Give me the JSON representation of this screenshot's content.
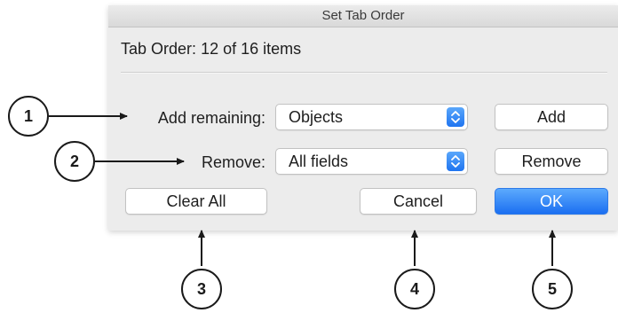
{
  "dialog": {
    "title": "Set Tab Order",
    "status_label": "Tab Order:",
    "status_value": "12 of 16 items",
    "add_remaining": {
      "label": "Add remaining:",
      "selected": "Objects",
      "button": "Add"
    },
    "remove": {
      "label": "Remove:",
      "selected": "All fields",
      "button": "Remove"
    },
    "buttons": {
      "clear_all": "Clear All",
      "cancel": "Cancel",
      "ok": "OK"
    }
  },
  "callouts": [
    "1",
    "2",
    "3",
    "4",
    "5"
  ],
  "colors": {
    "accent": "#1f74f0",
    "dialog_background": "#ececec"
  },
  "icons": {
    "popup_stepper": "updown-chevron-icon"
  }
}
